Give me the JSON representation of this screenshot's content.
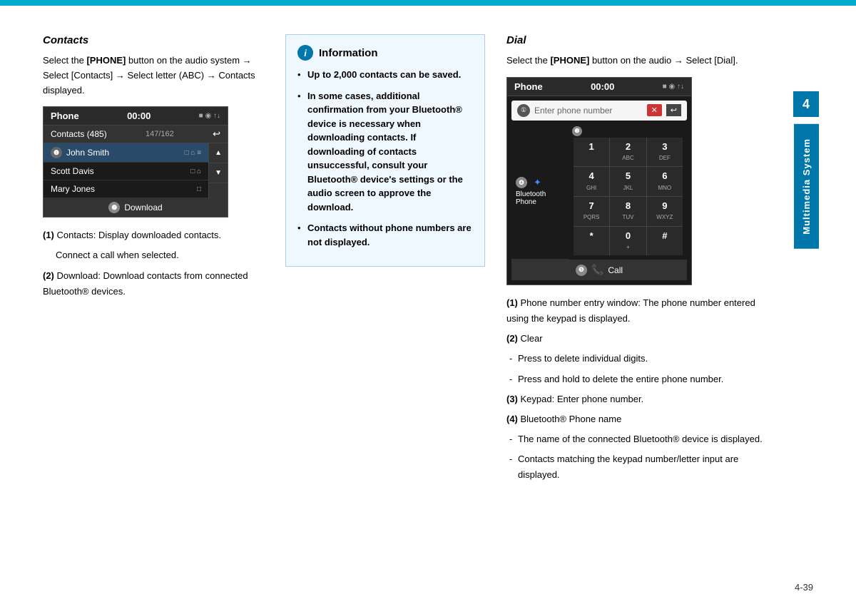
{
  "topBar": {
    "color": "#00aacc"
  },
  "leftColumn": {
    "title": "Contacts",
    "bodyText": "Select the [PHONE] button on the audio system → Select [Contacts] → Select letter (ABC) → Contacts displayed.",
    "phoneUI": {
      "header": {
        "title": "Phone",
        "time": "00:00",
        "icons": "■ ◉ ↑↓"
      },
      "contactsBar": {
        "label": "Contacts (485)",
        "count": "147/162"
      },
      "contacts": [
        {
          "name": "John Smith",
          "num": "1",
          "highlighted": true,
          "icons": "□ ⌂ ≡"
        },
        {
          "name": "Scott Davis",
          "icons": "□ ⌂"
        },
        {
          "name": "Mary Jones",
          "icons": "□"
        }
      ],
      "downloadLabel": "Download",
      "downloadBadge": "2"
    },
    "notes": [
      {
        "num": "(1)",
        "text": "Contacts: Display downloaded contacts.",
        "sub": "Connect a call when selected."
      },
      {
        "num": "(2)",
        "text": "Download: Download contacts from connected Bluetooth® devices."
      }
    ]
  },
  "middleColumn": {
    "infoBox": {
      "title": "Information",
      "items": [
        "Up to 2,000 contacts can be saved.",
        "In some cases, additional confirmation from your Bluetooth® device is necessary when downloading contacts. If downloading of contacts unsuccessful, consult your Bluetooth® device's settings or the audio screen to approve the download.",
        "Contacts without phone numbers are not displayed."
      ]
    }
  },
  "rightColumn": {
    "title": "Dial",
    "bodyText": "Select the [PHONE] button on the audio → Select [Dial].",
    "dialUI": {
      "header": {
        "title": "Phone",
        "time": "00:00",
        "icons": "■ ◉ ↑↓"
      },
      "inputPlaceholder": "Enter phone number",
      "inputNum": "1",
      "keypad": [
        {
          "main": "1",
          "sub": ""
        },
        {
          "main": "2",
          "sub": "ABC"
        },
        {
          "main": "3",
          "sub": "DEF"
        },
        {
          "main": "4",
          "sub": "GHI"
        },
        {
          "main": "5",
          "sub": "JKL"
        },
        {
          "main": "6",
          "sub": "MNO"
        },
        {
          "main": "7",
          "sub": "PQRS"
        },
        {
          "main": "8",
          "sub": "TUV"
        },
        {
          "main": "9",
          "sub": "WXYZ"
        },
        {
          "main": "*",
          "sub": ""
        },
        {
          "main": "0",
          "sub": "+"
        },
        {
          "main": "#",
          "sub": ""
        }
      ],
      "bluetoothPhone": "Bluetooth Phone",
      "bluetoothNum": "4",
      "keypadNum": "3",
      "callNum": "5",
      "callLabel": "Call"
    },
    "notes": [
      {
        "num": "(1)",
        "text": "Phone number entry window: The phone number entered using the keypad is displayed."
      },
      {
        "num": "(2)",
        "text": "Clear",
        "subs": [
          "Press to delete individual digits.",
          "Press and hold to delete the entire phone number."
        ]
      },
      {
        "num": "(3)",
        "text": "Keypad: Enter phone number."
      },
      {
        "num": "(4)",
        "text": "Bluetooth® Phone name",
        "subs": [
          "The name of the connected Bluetooth® device is displayed.",
          "Contacts matching the keypad number/letter input are displayed."
        ]
      }
    ]
  },
  "sidebar": {
    "chapterNum": "4",
    "chapterLabel": "Multimedia System"
  },
  "footer": {
    "pageNum": "4-39"
  }
}
